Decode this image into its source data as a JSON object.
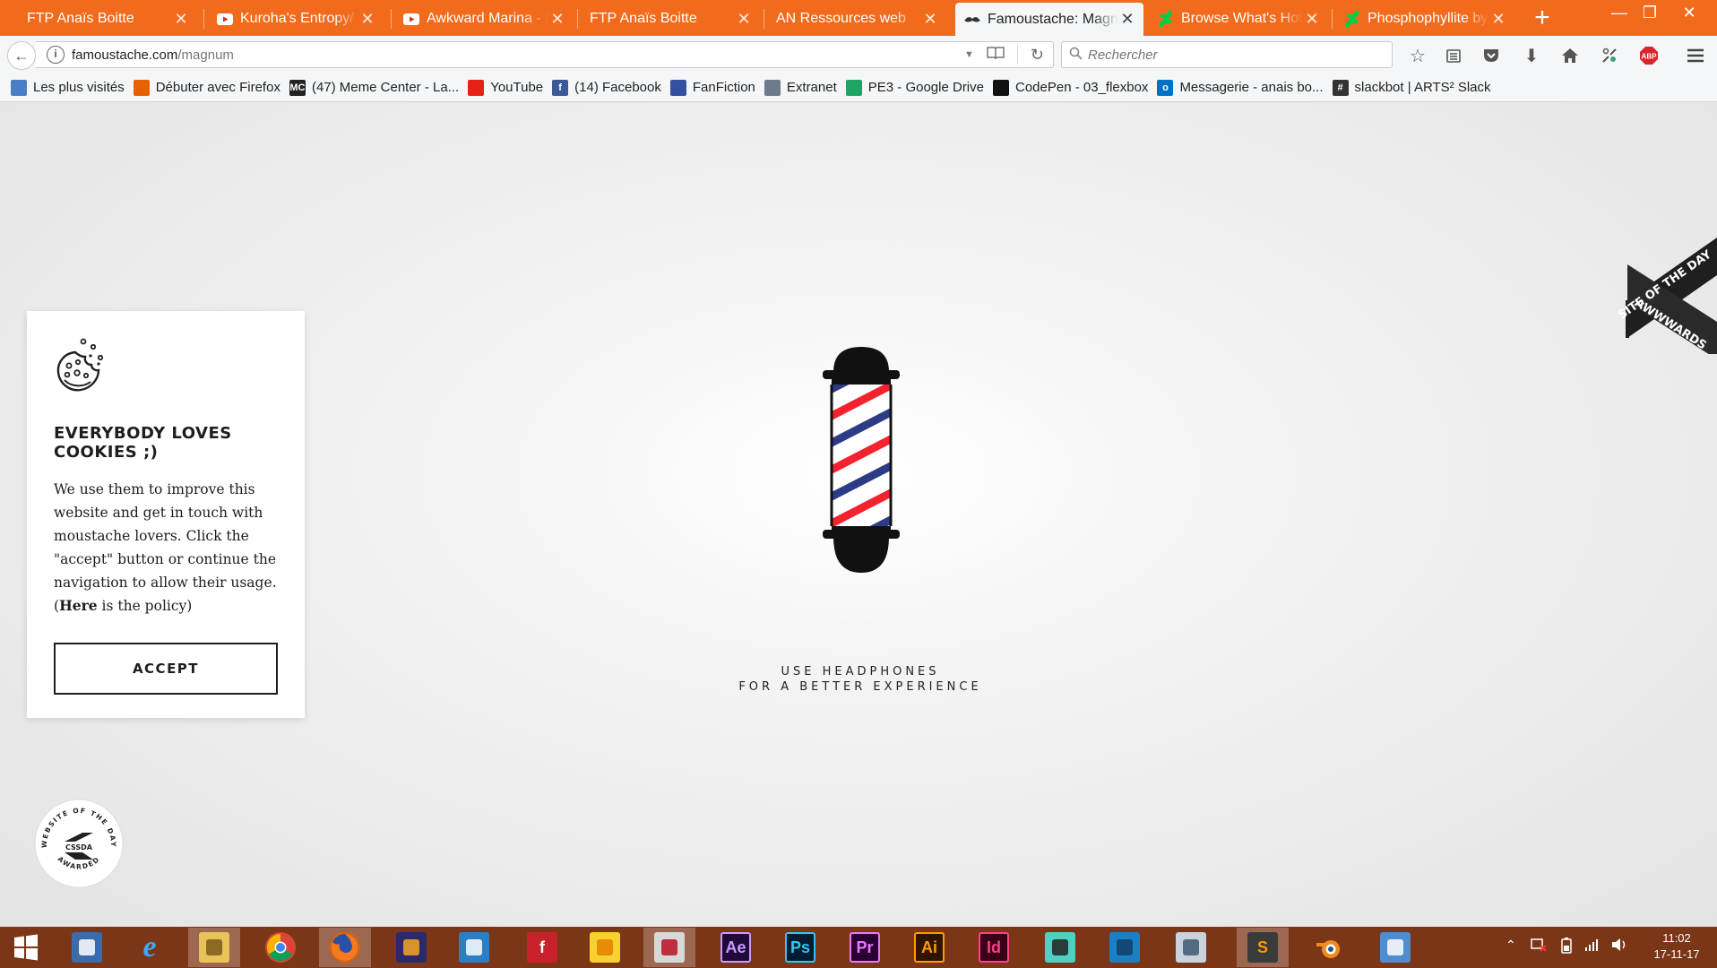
{
  "browser": {
    "tabs": [
      {
        "title": "FTP Anaïs Boitte",
        "icon": "none-icon"
      },
      {
        "title": "Kuroha's Entropy/ Si",
        "icon": "youtube-icon"
      },
      {
        "title": "Awkward Marina - E",
        "icon": "youtube-icon"
      },
      {
        "title": "FTP Anaïs Boitte",
        "icon": "none-icon"
      },
      {
        "title": "AN Ressources web",
        "icon": "none-icon"
      },
      {
        "title": "Famoustache: Magn",
        "icon": "moustache-icon"
      },
      {
        "title": "Browse What's Hot",
        "icon": "deviantart-icon"
      },
      {
        "title": "Phosphophyllite by",
        "icon": "deviantart-icon"
      }
    ],
    "url_host": "famoustache.com",
    "url_path": "/magnum",
    "search_placeholder": "Rechercher",
    "abp_label": "ABP",
    "bookmarks": [
      {
        "label": "Les plus visités",
        "icon": "most-visited-icon",
        "color": "#4a7ec7"
      },
      {
        "label": "Débuter avec Firefox",
        "icon": "firefox-icon",
        "color": "#e66000"
      },
      {
        "label": "(47) Meme Center - La...",
        "icon": "memecenter-icon",
        "color": "#222222",
        "glyph": "MC"
      },
      {
        "label": "YouTube",
        "icon": "youtube-icon",
        "color": "#e62117"
      },
      {
        "label": "(14) Facebook",
        "icon": "facebook-icon",
        "color": "#3b5998",
        "glyph": "f"
      },
      {
        "label": "FanFiction",
        "icon": "fanfiction-icon",
        "color": "#334fa0"
      },
      {
        "label": "Extranet",
        "icon": "extranet-icon",
        "color": "#6d7a8a"
      },
      {
        "label": "PE3 - Google Drive",
        "icon": "google-drive-icon",
        "color": "#1fa463"
      },
      {
        "label": "CodePen - 03_flexbox",
        "icon": "codepen-icon",
        "color": "#111111"
      },
      {
        "label": "Messagerie - anais bo...",
        "icon": "outlook-icon",
        "color": "#0072c6",
        "glyph": "o"
      },
      {
        "label": "slackbot | ARTS² Slack",
        "icon": "slack-icon",
        "color": "#333333",
        "glyph": "#"
      }
    ]
  },
  "page": {
    "cookie": {
      "title": "EVERYBODY LOVES COOKIES ;)",
      "text_before": "We use them to improve this website and get in touch with moustache lovers. Click the \"accept\" button or continue the navigation to allow their usage. (",
      "link": "Here",
      "text_after": " is the policy)",
      "button": "ACCEPT"
    },
    "headphones_line1": "USE HEADPHONES",
    "headphones_line2": "FOR A BETTER EXPERIENCE",
    "awwwards": {
      "top": "SITE OF THE DAY",
      "bottom": "AWWWARDS"
    },
    "cssda": {
      "ring": "WEBSITE OF THE DAY",
      "bottom": "AWARDED",
      "center": "CSSDA"
    },
    "colors": {
      "pole_red": "#f2232e",
      "pole_blue": "#2d3a86",
      "pole_black": "#111111"
    }
  },
  "taskbar": {
    "time": "11:02",
    "date": "17-11-17",
    "apps": [
      {
        "name": "start",
        "icon": "windows-icon"
      },
      {
        "name": "task-view",
        "icon": "chat-icon"
      },
      {
        "name": "internet-explorer",
        "icon": "ie-icon",
        "glyph": "e"
      },
      {
        "name": "file-explorer",
        "icon": "folder-icon"
      },
      {
        "name": "chrome",
        "icon": "chrome-icon"
      },
      {
        "name": "firefox",
        "icon": "firefox-icon"
      },
      {
        "name": "audacity",
        "icon": "headphones-icon"
      },
      {
        "name": "filezilla",
        "icon": "filezilla-icon"
      },
      {
        "name": "flash",
        "icon": "flash-icon",
        "glyph": "f"
      },
      {
        "name": "rubber-duck",
        "icon": "duck-icon"
      },
      {
        "name": "snipping",
        "icon": "scissors-icon"
      },
      {
        "name": "after-effects",
        "icon": "after-effects-icon",
        "glyph": "Ae"
      },
      {
        "name": "photoshop",
        "icon": "photoshop-icon",
        "glyph": "Ps"
      },
      {
        "name": "premiere",
        "icon": "premiere-icon",
        "glyph": "Pr"
      },
      {
        "name": "illustrator",
        "icon": "illustrator-icon",
        "glyph": "Ai"
      },
      {
        "name": "indesign",
        "icon": "indesign-icon",
        "glyph": "Id"
      },
      {
        "name": "miku",
        "icon": "miku-icon"
      },
      {
        "name": "cloud-app",
        "icon": "jacket-icon"
      },
      {
        "name": "monitor",
        "icon": "monitor-icon"
      },
      {
        "name": "sublime-text",
        "icon": "sublime-icon",
        "glyph": "S"
      },
      {
        "name": "blender",
        "icon": "blender-icon"
      },
      {
        "name": "remote-desktop",
        "icon": "remote-desktop-icon"
      }
    ]
  }
}
